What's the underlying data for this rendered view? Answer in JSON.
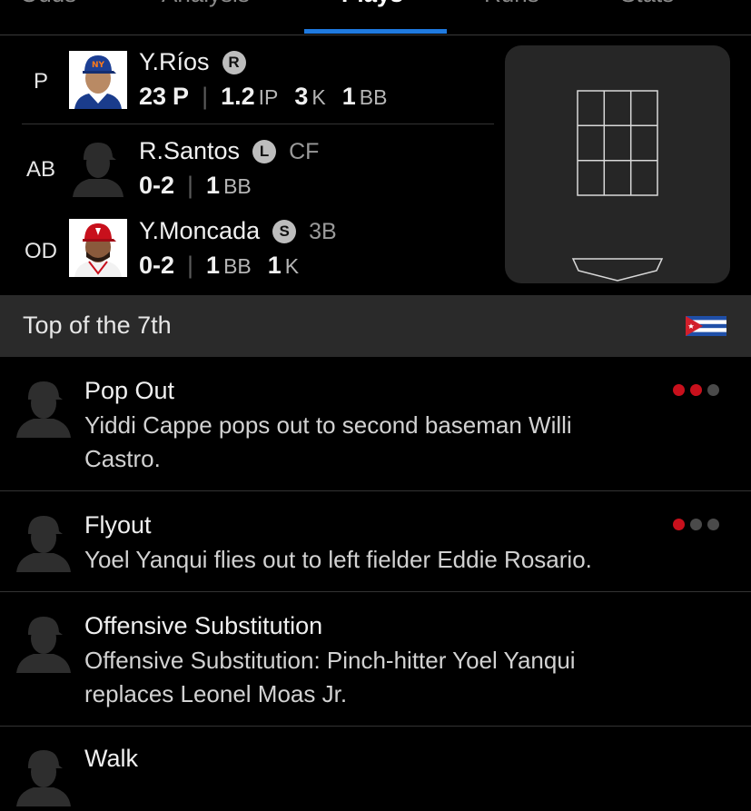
{
  "tabs": [
    {
      "label": "Odds",
      "active": false
    },
    {
      "label": "Analysis",
      "active": false
    },
    {
      "label": "Plays",
      "active": true
    },
    {
      "label": "Runs",
      "active": false
    },
    {
      "label": "Stats",
      "active": false
    }
  ],
  "matchup": {
    "pitcher": {
      "role": "P",
      "name": "Y.Ríos",
      "badge": "R",
      "stats": {
        "pitches": "23",
        "pitches_unit": "P",
        "ip": "1.2",
        "ip_unit": "IP",
        "k": "3",
        "k_unit": "K",
        "bb": "1",
        "bb_unit": "BB"
      }
    },
    "batter": {
      "role": "AB",
      "name": "R.Santos",
      "badge": "L",
      "position": "CF",
      "stats": {
        "line": "0-2",
        "bb": "1",
        "bb_unit": "BB"
      }
    },
    "on_deck": {
      "role": "OD",
      "name": "Y.Moncada",
      "badge": "S",
      "position": "3B",
      "stats": {
        "line": "0-2",
        "bb": "1",
        "bb_unit": "BB",
        "k": "1",
        "k_unit": "K"
      }
    }
  },
  "inning": {
    "label": "Top of the 7th",
    "team_flag_icon": "cuba-flag-icon"
  },
  "plays": [
    {
      "title": "Pop Out",
      "description": "Yiddi Cappe pops out to second baseman Willi Castro.",
      "outs": 2
    },
    {
      "title": "Flyout",
      "description": "Yoel Yanqui flies out to left fielder Eddie Rosario.",
      "outs": 1
    },
    {
      "title": "Offensive Substitution",
      "description": "Offensive Substitution: Pinch-hitter Yoel Yanqui replaces Leonel Moas Jr.",
      "outs": null
    },
    {
      "title": "Walk",
      "description": "",
      "outs": null
    }
  ],
  "colors": {
    "accent": "#1f7ae0",
    "out_on": "#c8101c",
    "out_off": "#4a4a4a",
    "panel": "#262626",
    "header": "#2a2a2a"
  }
}
